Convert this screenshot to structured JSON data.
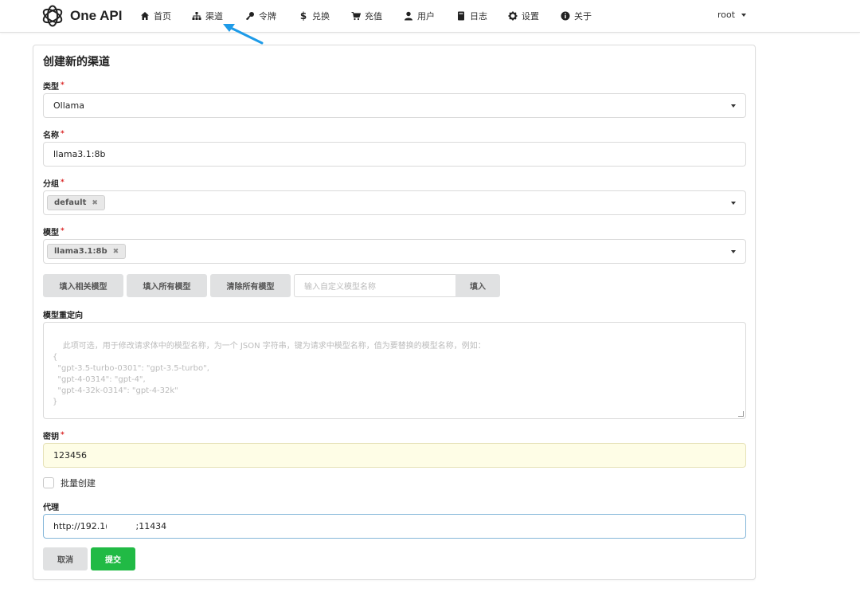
{
  "nav": {
    "brand": "One API",
    "items": [
      {
        "label": "首页",
        "icon": "home-icon"
      },
      {
        "label": "渠道",
        "icon": "sitemap-icon"
      },
      {
        "label": "令牌",
        "icon": "key-icon"
      },
      {
        "label": "兑换",
        "icon": "dollar-icon"
      },
      {
        "label": "充值",
        "icon": "cart-icon"
      },
      {
        "label": "用户",
        "icon": "user-icon"
      },
      {
        "label": "日志",
        "icon": "book-icon"
      },
      {
        "label": "设置",
        "icon": "gear-icon"
      },
      {
        "label": "关于",
        "icon": "info-icon"
      }
    ],
    "user": "root"
  },
  "form": {
    "title": "创建新的渠道",
    "type": {
      "label": "类型",
      "value": "Ollama"
    },
    "name": {
      "label": "名称",
      "value": "llama3.1:8b"
    },
    "group": {
      "label": "分组",
      "chips": [
        "default"
      ]
    },
    "models": {
      "label": "模型",
      "chips": [
        "llama3.1:8b"
      ]
    },
    "buttons": {
      "fill_related": "填入相关模型",
      "fill_all": "填入所有模型",
      "clear_all": "清除所有模型",
      "custom_placeholder": "输入自定义模型名称",
      "fill": "填入"
    },
    "model_mapping": {
      "label": "模型重定向",
      "placeholder": "此项可选，用于修改请求体中的模型名称，为一个 JSON 字符串，键为请求中模型名称，值为要替换的模型名称，例如：\n{\n  \"gpt-3.5-turbo-0301\": \"gpt-3.5-turbo\",\n  \"gpt-4-0314\": \"gpt-4\",\n  \"gpt-4-32k-0314\": \"gpt-4-32k\"\n}"
    },
    "key": {
      "label": "密钥",
      "value": "123456"
    },
    "batch": {
      "label": "批量创建"
    },
    "proxy": {
      "label": "代理",
      "value_prefix": "http://192.1(",
      "value_suffix": ";11434"
    },
    "cancel": "取消",
    "submit": "提交"
  }
}
